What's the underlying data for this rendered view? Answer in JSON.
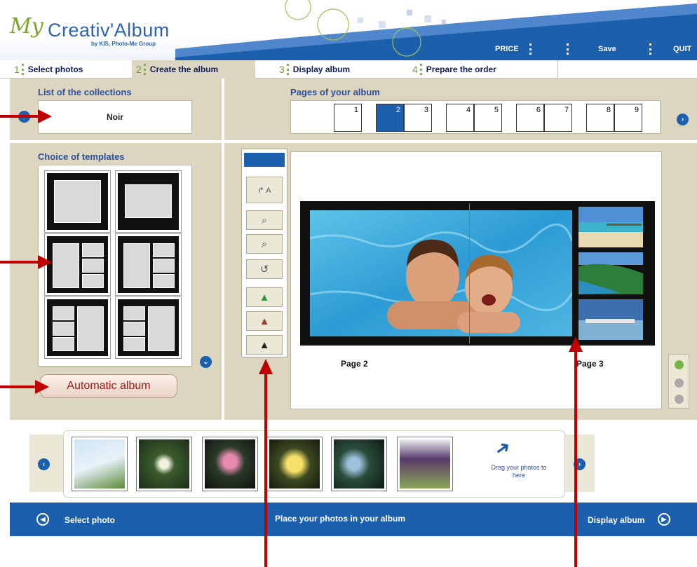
{
  "header": {
    "logo_my": "My",
    "logo_title": "Creativ'Album",
    "logo_sub": "by KIS, Photo-Me Group",
    "menu": [
      "PRICE",
      "Save",
      "QUIT"
    ]
  },
  "tabs": [
    {
      "num": "1",
      "label": "Select photos"
    },
    {
      "num": "2",
      "label": "Create the album"
    },
    {
      "num": "3",
      "label": "Display album"
    },
    {
      "num": "4",
      "label": "Prepare the order"
    }
  ],
  "collections": {
    "title": "List of the collections",
    "selected": "Noir"
  },
  "pages": {
    "title": "Pages of your album",
    "numbers": [
      "1",
      "2",
      "3",
      "4",
      "5",
      "6",
      "7",
      "8",
      "9"
    ],
    "active": "2"
  },
  "templates": {
    "title": "Choice of templates"
  },
  "auto_album_label": "Automatic album",
  "spread": {
    "left_label": "Page 2",
    "right_label": "Page 3"
  },
  "drag_hint": "Drag your photos to here",
  "status": {
    "left": "Select photo",
    "center": "Place your photos in your album",
    "right": "Display album"
  },
  "colors": {
    "brand_blue": "#1b5fad",
    "panel_beige": "#dcd6c0",
    "accent_green": "#7ab24a",
    "annotation_red": "#c00000"
  }
}
